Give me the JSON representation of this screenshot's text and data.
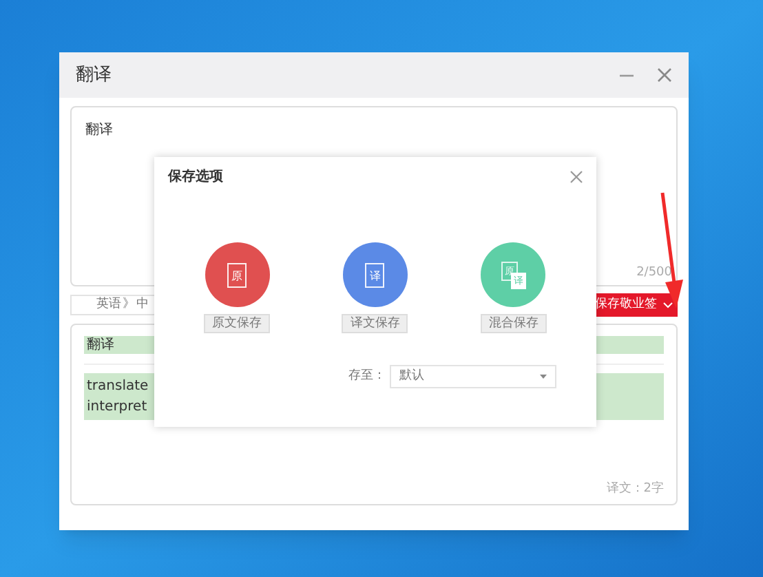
{
  "window": {
    "title": "翻译"
  },
  "source": {
    "text": "翻译",
    "counter": "2/500"
  },
  "language_bar": {
    "from": "英语",
    "separator": "》",
    "to": "中",
    "save_button": "保存敬业签"
  },
  "result": {
    "term": "翻译",
    "meanings": [
      "translate",
      "interpret"
    ],
    "count": "译文：2字"
  },
  "dialog": {
    "title": "保存选项",
    "options": [
      {
        "kind": "original",
        "glyphs": [
          "原"
        ],
        "color": "#e05050",
        "label": "原文保存"
      },
      {
        "kind": "translation",
        "glyphs": [
          "译"
        ],
        "color": "#5b8ae6",
        "label": "译文保存"
      },
      {
        "kind": "mixed",
        "glyphs": [
          "原",
          "译"
        ],
        "color": "#5ecfa6",
        "label": "混合保存"
      }
    ],
    "save_to": {
      "label": "存至：",
      "value": "默认"
    }
  }
}
